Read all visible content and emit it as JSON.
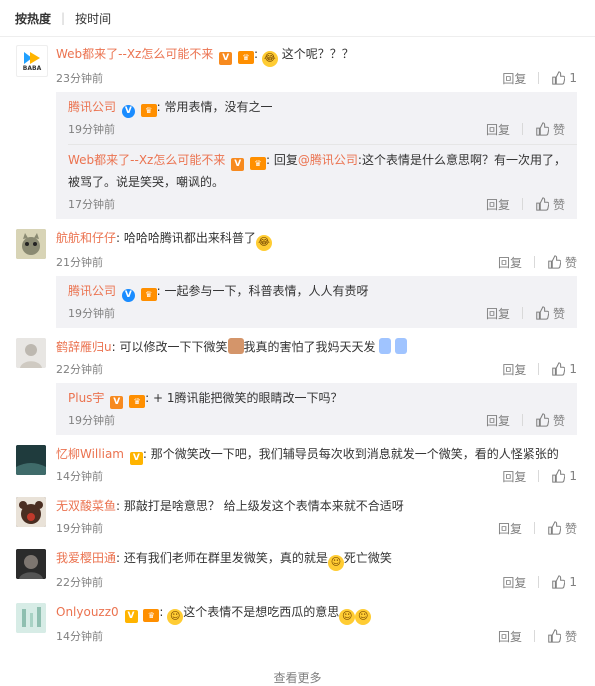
{
  "tabs": {
    "hot": "按热度",
    "time": "按时间"
  },
  "actions": {
    "reply": "回复",
    "like": "赞"
  },
  "more": "查看更多",
  "colors": {
    "username": "#eb7350",
    "reply_bg": "#f2f2f5",
    "meta": "#808080"
  },
  "comments": [
    {
      "avatar_text": "BABA",
      "user": "Web都来了--Xz怎么可能不来",
      "text": "这个呢？？？",
      "time": "23分钟前",
      "likes": "1",
      "replies": [
        {
          "user": "腾讯公司",
          "text": "常用表情，没有之一",
          "time": "19分钟前",
          "like_label": "赞"
        },
        {
          "user": "Web都来了--Xz怎么可能不来",
          "prefix": "回复",
          "mention": "@腾讯公司",
          "text": ":这个表情是什么意思啊？有一次用了，",
          "text2": "被骂了。说是笑哭，嘲讽的。",
          "time": "17分钟前",
          "like_label": "赞"
        }
      ]
    },
    {
      "user": "航航和仔仔",
      "text": "哈哈哈腾讯都出来科普了",
      "time": "21分钟前",
      "like_label": "赞",
      "replies": [
        {
          "user": "腾讯公司",
          "text": "一起参与一下，科普表情，人人有责呀",
          "time": "19分钟前",
          "like_label": "赞"
        }
      ]
    },
    {
      "user": "鹤辞雁归u",
      "text": "可以修改一下下微笑",
      "text_b": "我真的害怕了我妈天天发",
      "time": "22分钟前",
      "likes": "1",
      "replies": [
        {
          "user": "Plus宇",
          "text": "+ 1腾讯能把微笑的眼睛改一下吗？",
          "time": "19分钟前",
          "like_label": "赞"
        }
      ]
    },
    {
      "user": "忆柳William",
      "text": "那个微笑改一下吧，我们辅导员每次收到消息就发一个微笑，看的人怪紧张的",
      "time": "14分钟前",
      "likes": "1"
    },
    {
      "user": "无双酸菜鱼",
      "text": "那敲打是啥意思？ 给上级发这个表情本来就不合适呀",
      "time": "19分钟前",
      "like_label": "赞"
    },
    {
      "user": "我爱樱田通",
      "text": "还有我们老师在群里发微笑，真的就是",
      "text_b": "死亡微笑",
      "time": "22分钟前",
      "likes": "1"
    },
    {
      "user": "Onlyouzz0",
      "text": "这个表情不是想吃西瓜的意思",
      "time": "14分钟前",
      "like_label": "赞"
    }
  ]
}
